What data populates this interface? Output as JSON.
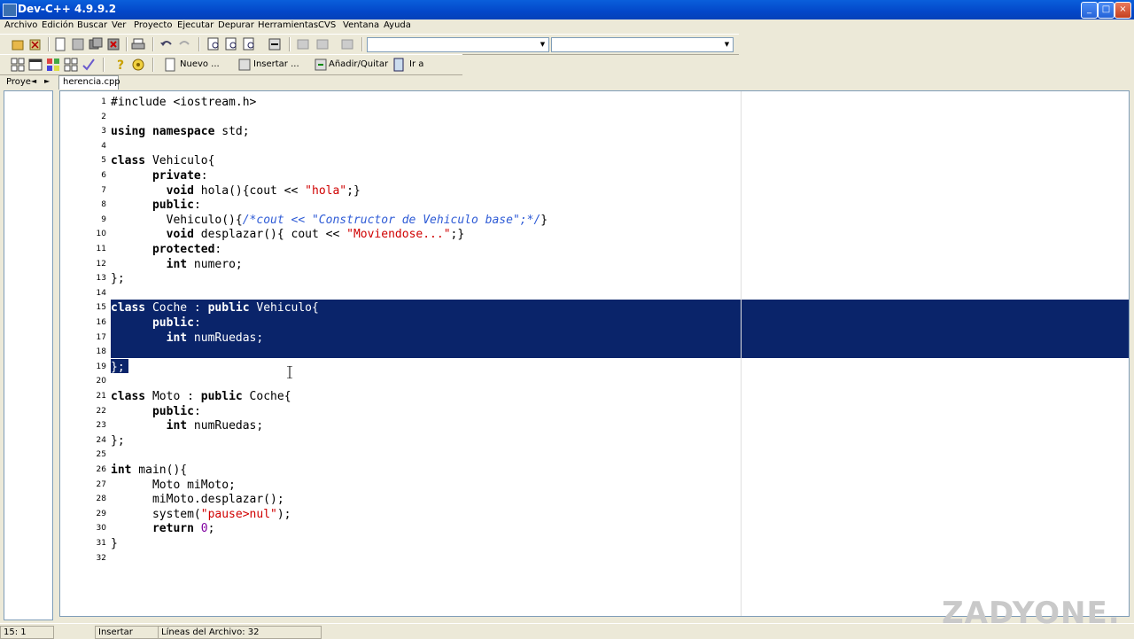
{
  "window": {
    "title": "Dev-C++ 4.9.9.2"
  },
  "menu": [
    "Archivo",
    "Edición",
    "Buscar",
    "Ver",
    "Proyecto",
    "Ejecutar",
    "Depurar",
    "Herramientas",
    "CVS",
    "Ventana",
    "Ayuda"
  ],
  "toolbar2": {
    "nuevo": "Nuevo ...",
    "insertar": "Insertar ...",
    "anadir": "Añadir/Quitar",
    "ira": "Ir a"
  },
  "panels": {
    "project_tab": "Proye",
    "file_tab": "herencia.cpp"
  },
  "status": {
    "position": "15: 1",
    "mode": "Insertar",
    "lines": "Líneas del Archivo: 32"
  },
  "watermark": "ZADYONE.",
  "colors": {
    "selection": "#0A246A",
    "keyword": "#000000",
    "string": "#d00000",
    "comment": "#2e5bd6",
    "number": "#8000a0"
  },
  "code_lines": [
    "#include <iostream.h>",
    "",
    "using namespace std;",
    "",
    "class Vehiculo{",
    "      private:",
    "        void hola(){cout << \"hola\";}",
    "      public:",
    "        Vehiculo(){/*cout << \"Constructor de Vehiculo base\";*/}",
    "        void desplazar(){ cout << \"Moviendose...\";}",
    "      protected:",
    "        int numero;",
    "};",
    "",
    "class Coche : public Vehiculo{",
    "      public:",
    "        int numRuedas;",
    "",
    "};",
    "",
    "class Moto : public Coche{",
    "      public:",
    "        int numRuedas;",
    "};",
    "",
    "int main(){",
    "      Moto miMoto;",
    "      miMoto.desplazar();",
    "      system(\"pause>nul\");",
    "      return 0;",
    "}",
    ""
  ]
}
